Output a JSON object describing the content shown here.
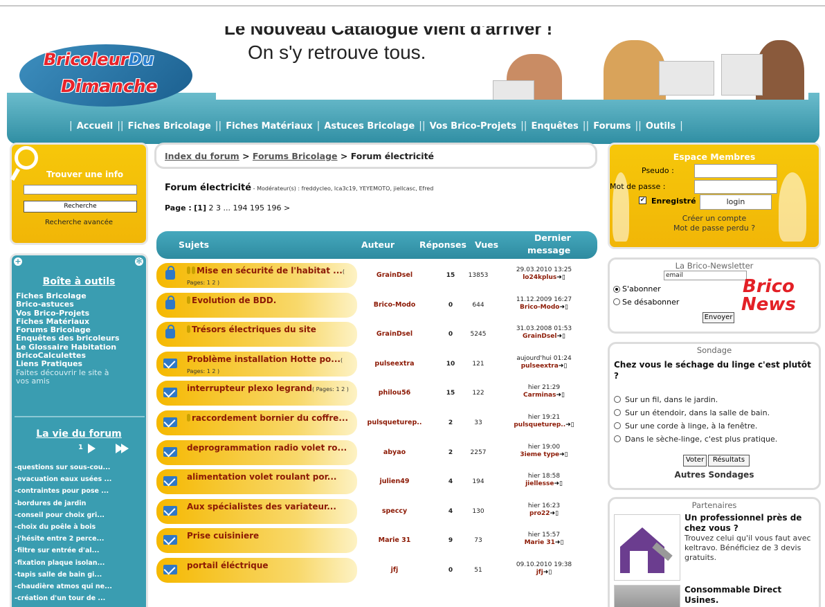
{
  "header": {
    "logo_part1": "Bricoleur",
    "logo_part2": "Du",
    "logo_part3": "Dimanche",
    "banner_top": "Le Nouveau Catalogue vient d'arriver !",
    "banner_main": "On s'y retrouve tous.",
    "nav": [
      "Accueil",
      "Fiches Bricolage",
      "Fiches Matériaux",
      "Astuces Bricolage",
      "Vos Brico-Projets",
      "Enquêtes",
      "Forums",
      "Outils"
    ]
  },
  "search": {
    "title": "Trouver une info",
    "button": "Recherche",
    "advanced": "Recherche avancée"
  },
  "toolbox": {
    "title": "Boîte à outils",
    "items": [
      "Fiches Bricolage",
      "Brico-astuces",
      "Vos Brico-Projets",
      "Fiches Matériaux",
      "Forums Bricolage",
      "Enquêtes des bricoleurs",
      "Le Glossaire Habitation",
      "BricoCalculettes",
      "Liens Pratiques",
      "Faites découvrir le site à",
      "vos amis"
    ]
  },
  "forum_life": {
    "title": "La vie du forum",
    "page": "1",
    "threads": [
      "-questions sur sous-cou...",
      "-evacuation eaux usées ...",
      "-contraintes pour pose ...",
      "-bordures de jardin",
      "-conseil pour choix gri...",
      "-choix du poêle à bois",
      "-j'hésite entre 2 perce...",
      "-filtre sur entrée d'al...",
      "-fixation plaque isolan...",
      "-tapis salle de bain gi...",
      "-chaudière atmos qui ne...",
      "-création d'un tour de ..."
    ]
  },
  "breadcrumb": {
    "index": "Index du forum",
    "sep": ">",
    "forums": "Forums Bricolage",
    "current": "Forum électricité"
  },
  "forum": {
    "title": "Forum électricité",
    "moderators": " - Modérateur(s) : freddycleo, lca3c19, YEYEMOTO, jiellcasc, Efred",
    "pager_label": "Page :",
    "pager_current": "[1]",
    "pager_rest": "2  3  ...  194  195  196  >"
  },
  "table": {
    "headers": [
      "Sujets",
      "Auteur",
      "Réponses",
      "Vues",
      "Dernier",
      "message"
    ],
    "rows": [
      {
        "icon": "lock",
        "subject": "Mise en sécurité de l'habitat ...",
        "pages": "( Pages: 1 2 )",
        "author": "GrainDsel",
        "replies": "15",
        "views": "13853",
        "date": "29.03.2010 13:25",
        "by": "lo24kplus",
        "pins": 2
      },
      {
        "icon": "lock",
        "subject": "Evolution de BDD.",
        "pages": "",
        "author": "Brico-Modo",
        "replies": "0",
        "views": "644",
        "date": "11.12.2009 16:27",
        "by": "Brico-Modo",
        "pins": 1
      },
      {
        "icon": "lock",
        "subject": "Trésors électriques du site",
        "pages": "",
        "author": "GrainDsel",
        "replies": "0",
        "views": "5245",
        "date": "31.03.2008 01:53",
        "by": "GrainDsel",
        "pins": 1
      },
      {
        "icon": "mail",
        "subject": "Problème installation Hotte po...",
        "pages": "( Pages: 1 2 )",
        "author": "pulseextra",
        "replies": "10",
        "views": "121",
        "date": "aujourd'hui 01:24",
        "by": "pulseextra",
        "pins": 0
      },
      {
        "icon": "mail",
        "subject": "interrupteur plexo legrand",
        "pages": "( Pages: 1 2 )",
        "author": "philou56",
        "replies": "15",
        "views": "122",
        "date": "hier 21:29",
        "by": "Carminas",
        "pins": 0
      },
      {
        "icon": "mail",
        "subject": "raccordement bornier du coffre...",
        "pages": "",
        "author": "pulsqueturep..",
        "replies": "2",
        "views": "33",
        "date": "hier 19:21",
        "by": "pulsqueturep..",
        "pins": 1
      },
      {
        "icon": "mail",
        "subject": "deprogrammation radio volet ro...",
        "pages": "",
        "author": "abyao",
        "replies": "2",
        "views": "2257",
        "date": "hier 19:00",
        "by": "3ieme type",
        "pins": 0
      },
      {
        "icon": "mail",
        "subject": "alimentation volet roulant por...",
        "pages": "",
        "author": "julien49",
        "replies": "4",
        "views": "194",
        "date": "hier 18:58",
        "by": "jiellesse",
        "pins": 0
      },
      {
        "icon": "mail",
        "subject": "Aux spécialistes des variateur...",
        "pages": "",
        "author": "speccy",
        "replies": "4",
        "views": "130",
        "date": "hier 16:23",
        "by": "pro22",
        "pins": 0
      },
      {
        "icon": "mail",
        "subject": "Prise cuisiniere",
        "pages": "",
        "author": "Marie 31",
        "replies": "9",
        "views": "73",
        "date": "hier 15:57",
        "by": "Marie 31",
        "pins": 0
      },
      {
        "icon": "mail",
        "subject": "portail éléctrique",
        "pages": "",
        "author": "jfj",
        "replies": "0",
        "views": "51",
        "date": "09.10.2010 19:38",
        "by": "jfj",
        "pins": 0
      }
    ]
  },
  "members": {
    "title": "Espace Membres",
    "pseudo_label": "Pseudo :",
    "password_label": "Mot de passe :",
    "remember_label": "Enregistré",
    "login": "login",
    "create": "Créer un compte",
    "lost": "Mot de passe perdu ?"
  },
  "newsletter": {
    "title": "La Brico-Newsletter",
    "email_value": "email",
    "subscribe": "S'abonner",
    "unsubscribe": "Se désabonner",
    "send": "Envoyer",
    "logo1": "Brico",
    "logo2": "News"
  },
  "poll": {
    "title": "Sondage",
    "question": "Chez vous le séchage du linge c'est plutôt ?",
    "options": [
      "Sur un fil, dans le jardin.",
      "Sur un étendoir, dans la salle de bain.",
      "Sur une corde à linge, à la fenêtre.",
      "Dans le sèche-linge, c'est plus pratique."
    ],
    "vote": "Voter",
    "results": "Résultats",
    "more": "Autres Sondages"
  },
  "partners": {
    "title": "Partenaires",
    "p1_head": "Un professionnel près de chez vous ?",
    "p1_text": "Trouvez celui qu'il vous faut avec keltravo. Bénéficiez de 3 devis gratuits.",
    "p2_head": "Consommable Direct Usines."
  },
  "colors": {
    "teal": "#3a9db1",
    "yellow": "#f6c70a",
    "subject_red": "#8c1a05",
    "mail_blue": "#2f78c6"
  }
}
